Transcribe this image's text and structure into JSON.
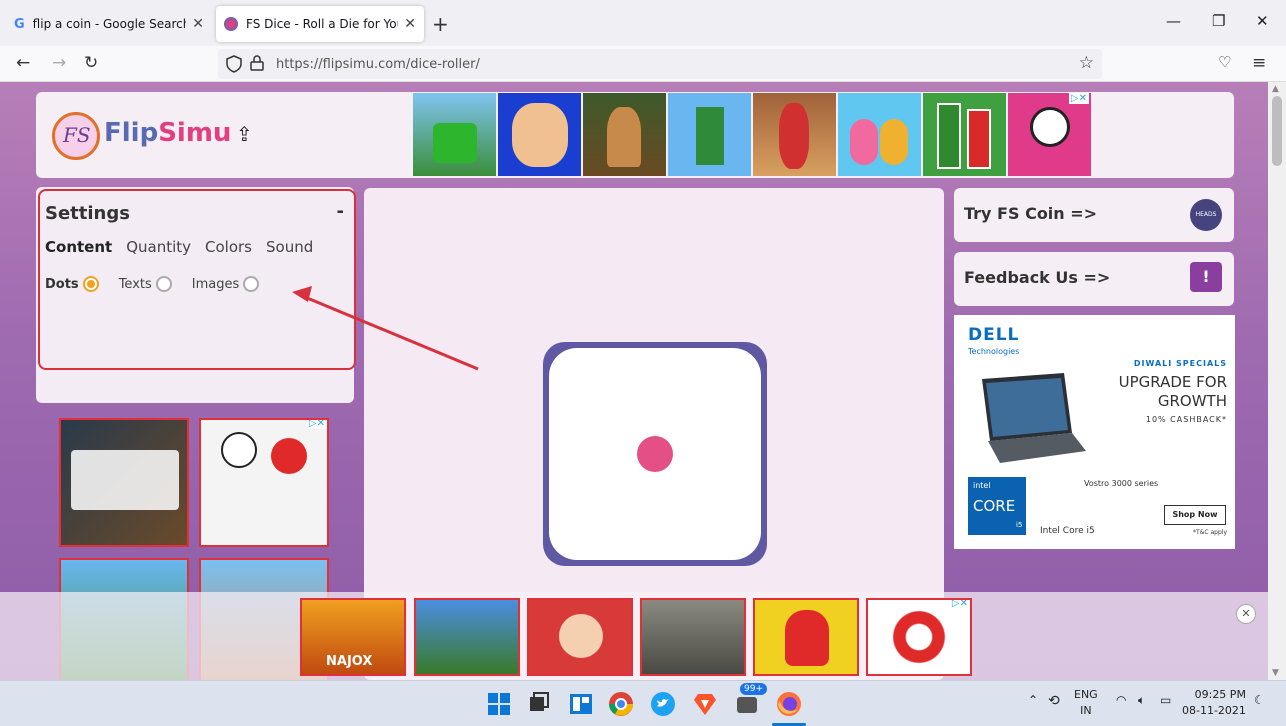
{
  "browser": {
    "tabs": [
      {
        "title": "flip a coin - Google Search",
        "active": false
      },
      {
        "title": "FS Dice - Roll a Die for Your Gam",
        "active": true
      }
    ],
    "url": "https://flipsimu.com/dice-roller/"
  },
  "site": {
    "brand_part1": "Flip",
    "brand_part2": "Simu",
    "logo_text": "FS"
  },
  "settings": {
    "title": "Settings",
    "collapse": "-",
    "tabs": [
      "Content",
      "Quantity",
      "Colors",
      "Sound"
    ],
    "options": [
      {
        "label": "Dots",
        "selected": true
      },
      {
        "label": "Texts",
        "selected": false
      },
      {
        "label": "Images",
        "selected": false
      }
    ]
  },
  "die": {
    "pips": 1,
    "pip_color": "#e44f86",
    "border_color": "#5f58a3"
  },
  "right": {
    "coin_link": "Try FS Coin =>",
    "coin_badge": "HEADS",
    "feedback_link": "Feedback Us =>",
    "feedback_icon": "!"
  },
  "dell_ad": {
    "logo": "DELL",
    "logo_sub": "Technologies",
    "headline_small": "DIWALI SPECIALS",
    "headline_line1": "UPGRADE FOR",
    "headline_line2": "GROWTH",
    "cashback": "10% CASHBACK*",
    "model": "Vostro 3000 series",
    "intel_brand": "intel",
    "intel_core": "CORE",
    "intel_gen": "i5",
    "processor": "Intel Core i5",
    "cta": "Shop Now",
    "tc": "*T&C apply"
  },
  "bottom_ad": {
    "tile_caption": "NAJOX",
    "close": "✕"
  },
  "taskbar": {
    "badge": "99+",
    "lang1": "ENG",
    "lang2": "IN",
    "time": "09:25 PM",
    "date": "08-11-2021"
  },
  "colors": {
    "accent_pink": "#e33e7f",
    "accent_purple": "#5a6ab0",
    "highlight_red": "#d8303d",
    "radio_selected": "#f4a020"
  }
}
